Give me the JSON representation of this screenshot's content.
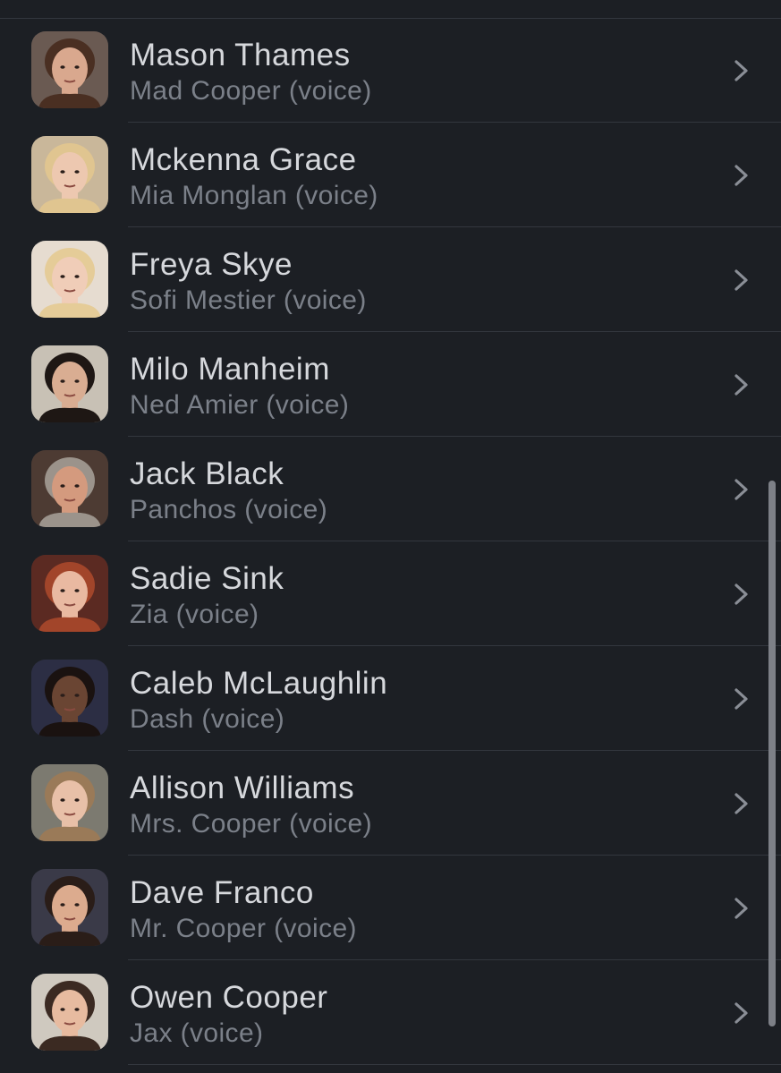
{
  "cast": [
    {
      "actor": "Mason Thames",
      "role": "Mad Cooper (voice)",
      "avatar": {
        "bg": "#6a5a52",
        "skin": "#d9a88e",
        "hair": "#4a2f22"
      }
    },
    {
      "actor": "Mckenna Grace",
      "role": "Mia Monglan (voice)",
      "avatar": {
        "bg": "#c9b79a",
        "skin": "#edc8b0",
        "hair": "#e0c590"
      }
    },
    {
      "actor": "Freya Skye",
      "role": "Sofi Mestier (voice)",
      "avatar": {
        "bg": "#e6dcd0",
        "skin": "#f0cdb8",
        "hair": "#e5cc98"
      }
    },
    {
      "actor": "Milo Manheim",
      "role": "Ned Amier (voice)",
      "avatar": {
        "bg": "#c8c1b5",
        "skin": "#d9ad92",
        "hair": "#1e1714"
      }
    },
    {
      "actor": "Jack Black",
      "role": "Panchos (voice)",
      "avatar": {
        "bg": "#4d3b33",
        "skin": "#d49a7e",
        "hair": "#9b938b"
      }
    },
    {
      "actor": "Sadie Sink",
      "role": "Zia (voice)",
      "avatar": {
        "bg": "#5b2a22",
        "skin": "#e9b9a1",
        "hair": "#a2452a"
      }
    },
    {
      "actor": "Caleb McLaughlin",
      "role": "Dash (voice)",
      "avatar": {
        "bg": "#2c2e44",
        "skin": "#6a4533",
        "hair": "#1a1210"
      }
    },
    {
      "actor": "Allison Williams",
      "role": "Mrs. Cooper (voice)",
      "avatar": {
        "bg": "#7c7a70",
        "skin": "#e8c0a8",
        "hair": "#9a7a58"
      }
    },
    {
      "actor": "Dave Franco",
      "role": "Mr. Cooper (voice)",
      "avatar": {
        "bg": "#3a3a48",
        "skin": "#dcab8e",
        "hair": "#2a1d18"
      }
    },
    {
      "actor": "Owen Cooper",
      "role": "Jax (voice)",
      "avatar": {
        "bg": "#cfc9bf",
        "skin": "#e7bba0",
        "hair": "#3b2a22"
      }
    }
  ],
  "icons": {
    "row_chevron": "chevron-right-icon"
  },
  "colors": {
    "background": "#1c1f24",
    "actor_text": "#d6d8dc",
    "role_text": "#7b8089",
    "divider": "#33373e",
    "chevron": "#8a8e96",
    "scrollbar": "#7d8087"
  }
}
